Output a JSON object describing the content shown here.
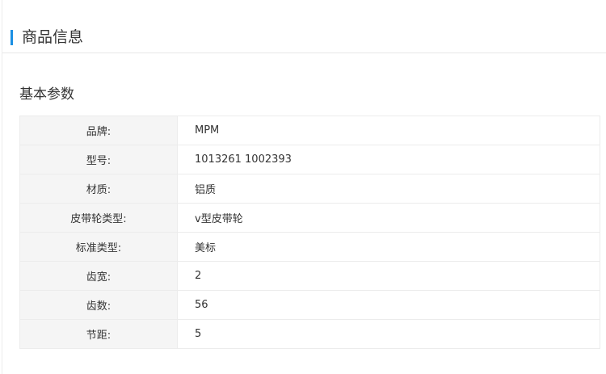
{
  "header": {
    "title": "商品信息",
    "accent_color": "#1a8fe3"
  },
  "section": {
    "title": "基本参数"
  },
  "specs": [
    {
      "label": "品牌:",
      "value": "MPM"
    },
    {
      "label": "型号:",
      "value": "1013261 1002393"
    },
    {
      "label": "材质:",
      "value": "铝质"
    },
    {
      "label": "皮带轮类型:",
      "value": "v型皮带轮"
    },
    {
      "label": "标准类型:",
      "value": "美标"
    },
    {
      "label": "齿宽:",
      "value": "2"
    },
    {
      "label": "齿数:",
      "value": "56"
    },
    {
      "label": "节距:",
      "value": "5"
    }
  ]
}
